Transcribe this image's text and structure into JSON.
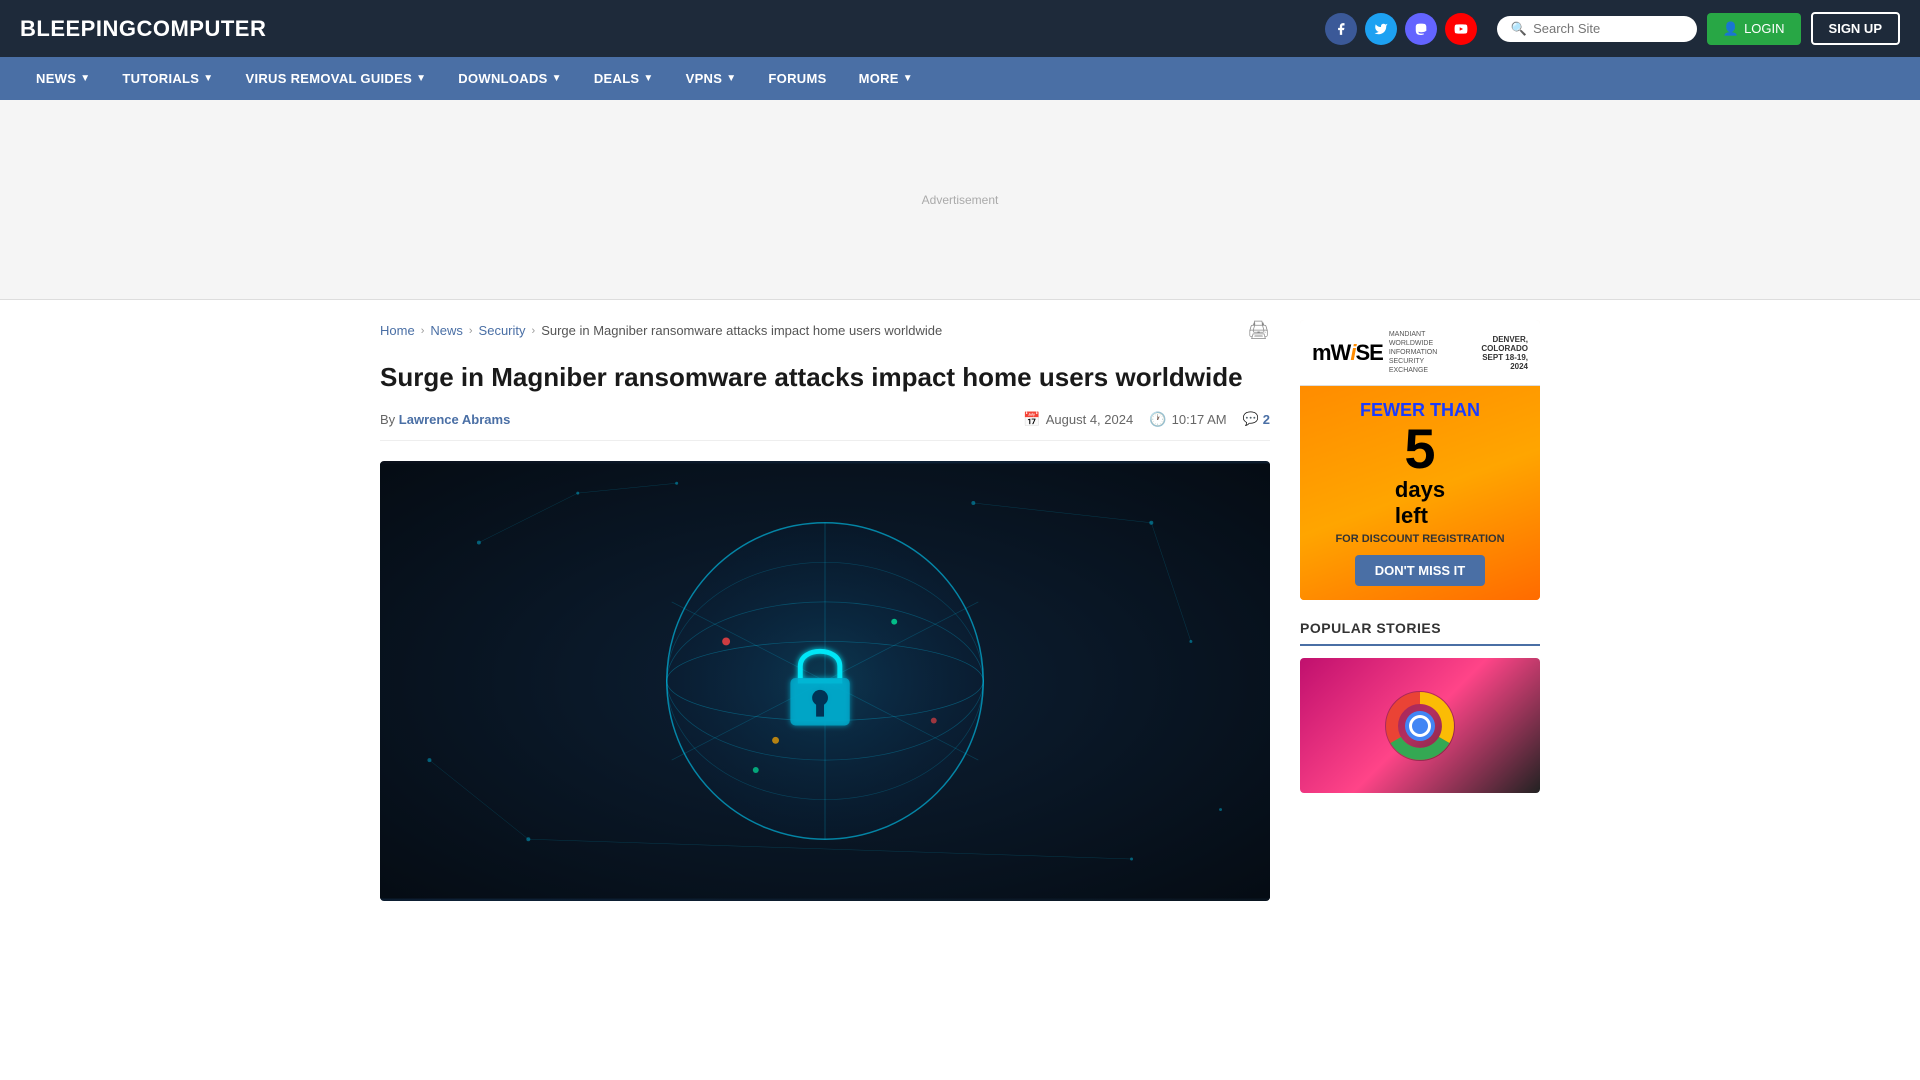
{
  "header": {
    "logo_part1": "BLEEPING",
    "logo_part2": "COMPUTER",
    "social": [
      {
        "name": "facebook",
        "icon": "f"
      },
      {
        "name": "twitter",
        "icon": "t"
      },
      {
        "name": "mastodon",
        "icon": "m"
      },
      {
        "name": "youtube",
        "icon": "▶"
      }
    ],
    "search_placeholder": "Search Site",
    "login_label": "LOGIN",
    "signup_label": "SIGN UP"
  },
  "nav": {
    "items": [
      {
        "label": "NEWS",
        "has_dropdown": true
      },
      {
        "label": "TUTORIALS",
        "has_dropdown": true
      },
      {
        "label": "VIRUS REMOVAL GUIDES",
        "has_dropdown": true
      },
      {
        "label": "DOWNLOADS",
        "has_dropdown": true
      },
      {
        "label": "DEALS",
        "has_dropdown": true
      },
      {
        "label": "VPNS",
        "has_dropdown": true
      },
      {
        "label": "FORUMS",
        "has_dropdown": false
      },
      {
        "label": "MORE",
        "has_dropdown": true
      }
    ]
  },
  "breadcrumb": {
    "home": "Home",
    "news": "News",
    "security": "Security",
    "current": "Surge in Magniber ransomware attacks impact home users worldwide"
  },
  "article": {
    "title": "Surge in Magniber ransomware attacks impact home users worldwide",
    "author_prefix": "By",
    "author_name": "Lawrence Abrams",
    "date": "August 4, 2024",
    "time": "10:17 AM",
    "comments_count": "2"
  },
  "sidebar_ad": {
    "logo_text1": "mW",
    "logo_text2": "SE",
    "logo_i": "i",
    "subtitle": "MANDIANT WORLDWIDE\nINFORMATION SECURITY EXCHANGE",
    "location": "DENVER, COLORADO\nSEPT 18-19, 2024",
    "fewer_than": "FEWER THAN",
    "number": "5",
    "days_left": "days\nleft",
    "discount_text": "FOR DISCOUNT REGISTRATION",
    "cta_button": "DON'T MISS IT"
  },
  "popular_stories": {
    "title": "POPULAR STORIES"
  }
}
